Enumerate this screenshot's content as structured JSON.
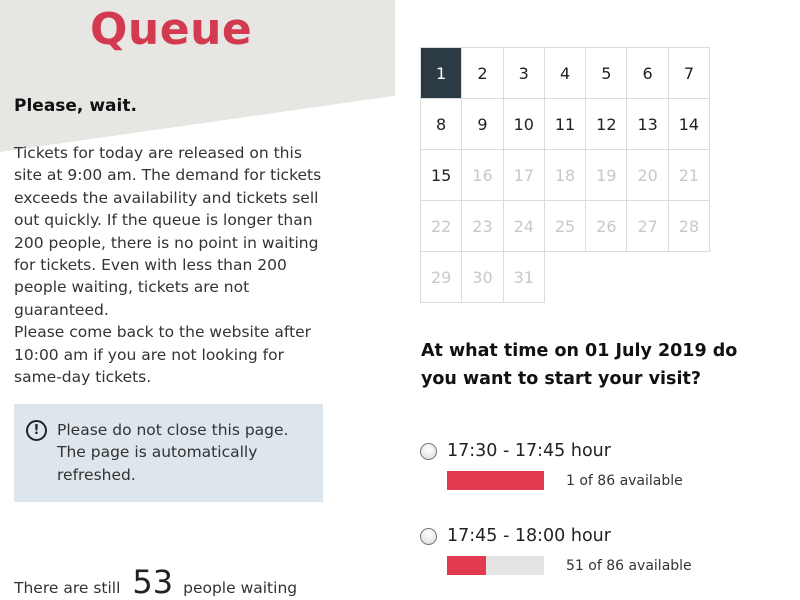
{
  "header": {
    "title": "Queue"
  },
  "info": {
    "heading": "Please, wait.",
    "paragraph1": "Tickets for today are released on this site at 9:00 am. The demand for tickets exceeds the availability and tickets sell out quickly. If the queue is longer than 200 people, there is no point in waiting for tickets. Even with less than 200 people waiting, tickets are not guaranteed.",
    "paragraph2": "Please come back to the website after 10:00 am if you are not looking for same-day tickets."
  },
  "notice": {
    "icon": "exclamation-circle-icon",
    "text": "Please do not close this page. The page is automatically refreshed."
  },
  "waiting": {
    "prefix": "There are still",
    "count": "53",
    "suffix": "people waiting"
  },
  "calendar": {
    "selected": 1,
    "days": [
      {
        "label": "1",
        "state": "selected"
      },
      {
        "label": "2",
        "state": "available"
      },
      {
        "label": "3",
        "state": "available"
      },
      {
        "label": "4",
        "state": "available"
      },
      {
        "label": "5",
        "state": "available"
      },
      {
        "label": "6",
        "state": "available"
      },
      {
        "label": "7",
        "state": "available"
      },
      {
        "label": "8",
        "state": "available"
      },
      {
        "label": "9",
        "state": "available"
      },
      {
        "label": "10",
        "state": "available"
      },
      {
        "label": "11",
        "state": "available"
      },
      {
        "label": "12",
        "state": "available"
      },
      {
        "label": "13",
        "state": "available"
      },
      {
        "label": "14",
        "state": "available"
      },
      {
        "label": "15",
        "state": "available"
      },
      {
        "label": "16",
        "state": "disabled"
      },
      {
        "label": "17",
        "state": "disabled"
      },
      {
        "label": "18",
        "state": "disabled"
      },
      {
        "label": "19",
        "state": "disabled"
      },
      {
        "label": "20",
        "state": "disabled"
      },
      {
        "label": "21",
        "state": "disabled"
      },
      {
        "label": "22",
        "state": "disabled"
      },
      {
        "label": "23",
        "state": "disabled"
      },
      {
        "label": "24",
        "state": "disabled"
      },
      {
        "label": "25",
        "state": "disabled"
      },
      {
        "label": "26",
        "state": "disabled"
      },
      {
        "label": "27",
        "state": "disabled"
      },
      {
        "label": "28",
        "state": "disabled"
      },
      {
        "label": "29",
        "state": "disabled"
      },
      {
        "label": "30",
        "state": "disabled"
      },
      {
        "label": "31",
        "state": "disabled"
      }
    ]
  },
  "question": "At what time on 01 July 2019 do you want to start your visit?",
  "slots": [
    {
      "label": "17:30 - 17:45 hour",
      "availability": "1 of 86 available",
      "fill_fraction": 1.0
    },
    {
      "label": "17:45 - 18:00 hour",
      "availability": "51 of 86 available",
      "fill_fraction": 0.4
    }
  ],
  "colors": {
    "brand_red": "#d43a4f",
    "bar_fill": "#e23a4e",
    "selected_day": "#2c3a43",
    "notice_bg": "#dce6ec"
  }
}
